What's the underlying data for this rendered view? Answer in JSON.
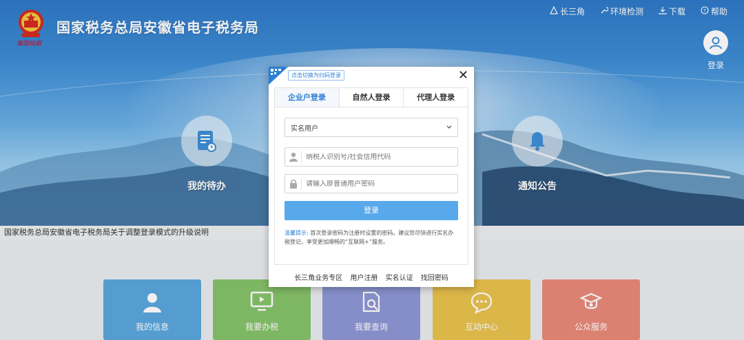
{
  "header": {
    "site_title": "国家税务总局安徽省电子税务局",
    "signature": "肇國稅嶽",
    "nav": [
      {
        "label": "长三角",
        "icon": "triangle-icon"
      },
      {
        "label": "环境检测",
        "icon": "wrench-icon"
      },
      {
        "label": "下载",
        "icon": "download-icon"
      },
      {
        "label": "帮助",
        "icon": "help-icon"
      }
    ],
    "login_label": "登录"
  },
  "features": {
    "todo_label": "我的待办",
    "notice_label": "通知公告"
  },
  "notice_bar": "国家税务总局安徽省电子税务局关于调整登录模式的升级说明",
  "tiles": [
    {
      "label": "我的信息",
      "color": "#5ba7dd"
    },
    {
      "label": "我要办税",
      "color": "#86c36a"
    },
    {
      "label": "我要查询",
      "color": "#8e97d5"
    },
    {
      "label": "互动中心",
      "color": "#e9c24d"
    },
    {
      "label": "公众服务",
      "color": "#e98a7a"
    }
  ],
  "modal": {
    "qr_tip": "点击切换为扫码登录",
    "close": "✕",
    "tabs": [
      "企业户登录",
      "自然人登录",
      "代理人登录"
    ],
    "select_value": "实名用户",
    "user_placeholder": "纳税人识别号/社会信用代码",
    "pwd_placeholder": "请输入原普通用户密码",
    "login_button": "登录",
    "tip_label": "温馨提示:",
    "tip_text": "首次登录密码为注册时设置的密码。建议您尽快进行实名办税登记，享受更加顺畅的“互联网+”服务。",
    "links": [
      "长三角业务专区",
      "用户注册",
      "实名认证",
      "找回密码"
    ]
  },
  "colors": {
    "accent": "#2a7fd4",
    "button": "#58a9ec"
  }
}
